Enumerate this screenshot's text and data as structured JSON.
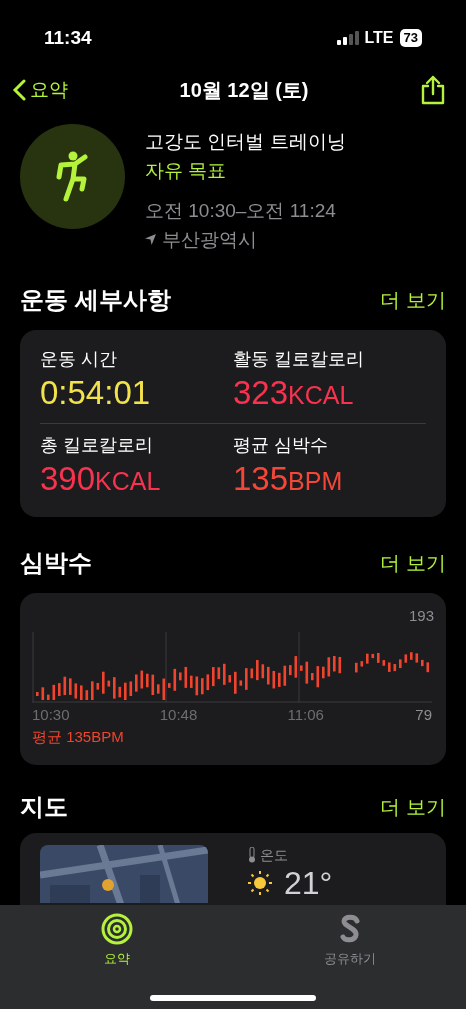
{
  "status_bar": {
    "time": "11:34",
    "network": "LTE",
    "battery": "73"
  },
  "nav": {
    "back": "요약",
    "title": "10월 12일 (토)"
  },
  "workout": {
    "name": "고강도 인터벌 트레이닝",
    "goal": "자유 목표",
    "time_range": "오전 10:30–오전 11:24",
    "location": "부산광역시"
  },
  "details": {
    "title": "운동 세부사항",
    "more": "더 보기",
    "stats": [
      {
        "label": "운동 시간",
        "value": "0:54:01",
        "color": "#f2e24b"
      },
      {
        "label": "활동 킬로칼로리",
        "value": "323",
        "unit": "KCAL",
        "color": "#f8324f"
      },
      {
        "label": "총 킬로칼로리",
        "value": "390",
        "unit": "KCAL",
        "color": "#f8324f"
      },
      {
        "label": "평균 심박수",
        "value": "135",
        "unit": "BPM",
        "color": "#f4473a"
      }
    ]
  },
  "heart": {
    "title": "심박수",
    "more": "더 보기",
    "max": "193",
    "min": "79",
    "times": [
      "10:30",
      "10:48",
      "11:06"
    ],
    "average": "평균 135BPM"
  },
  "map": {
    "title": "지도",
    "more": "더 보기",
    "temperature_label": "온도",
    "temperature": "21°"
  },
  "tabs": [
    {
      "label": "요약",
      "selected": true
    },
    {
      "label": "공유하기",
      "selected": false
    }
  ]
}
